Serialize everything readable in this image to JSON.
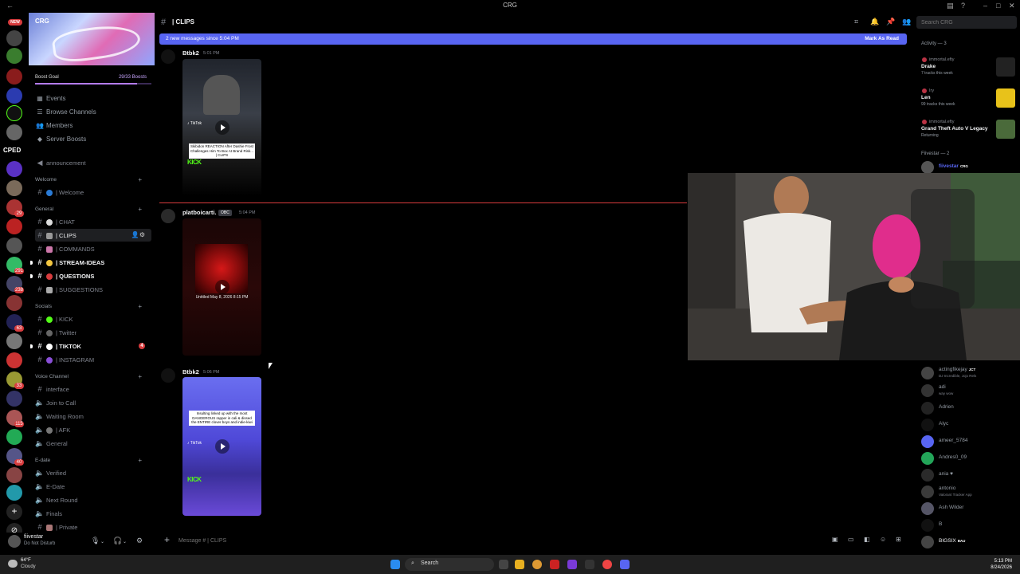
{
  "window": {
    "title": "CRG"
  },
  "rail": {
    "new_badge": "NEW",
    "cped_label": "CPED",
    "badges": [
      "29",
      "291",
      "238",
      "63",
      "33",
      "115",
      "40"
    ]
  },
  "server": {
    "name": "CRG",
    "boost_label": "Boost Goal",
    "boost_value": "29/33 Boosts",
    "boost_progress": 0.88
  },
  "nav": {
    "events": "Events",
    "browse": "Browse Channels",
    "members": "Members",
    "boosts": "Server Boosts"
  },
  "channels": {
    "announcement": "announcement",
    "cat_welcome": "Welcome",
    "welcome": "| Welcome",
    "cat_general": "General",
    "chat": "| CHAT",
    "clips": "| CLIPS",
    "commands": "| COMMANDS",
    "stream_ideas": "| STREAM-IDEAS",
    "questions": "| QUESTIONS",
    "suggestions": "| SUGGESTIONS",
    "cat_socials": "Socials",
    "kick": "| KICK",
    "twitter": "| Twitter",
    "tiktok": "| TIKTOK",
    "tiktok_badge": "4",
    "instagram": "| INSTAGRAM",
    "cat_voice": "Voice Channel",
    "interface": "interface",
    "join_call": "Join to Call",
    "waiting": "Waiting Room",
    "afk": "| AFK",
    "general": "General",
    "cat_edate": "E-date",
    "verified": "Verified",
    "edate": "E-Date",
    "next_round": "Next Round",
    "finals": "Finals",
    "private": "| Private"
  },
  "user": {
    "name": "fiivestar",
    "status": "Do Not Disturb"
  },
  "header": {
    "channel": "| CLIPS",
    "search_placeholder": "Search CRG"
  },
  "new_messages": {
    "text": "2 new messages since 5:04 PM",
    "mark_read": "Mark As Read"
  },
  "messages": [
    {
      "author": "Btbk2",
      "time": "5:01 PM",
      "caption": "Skibidon REACTION After Dashie Frost Challenges Him To Box At Brand Risk... | CLIPS",
      "kick": "KICK"
    },
    {
      "author": "platboicarti.",
      "tag": "OBC",
      "time": "5:04 PM",
      "title": "Untitled May 8, 2026 8:15 PM"
    },
    {
      "author": "Btbk2",
      "time": "5:06 PM",
      "caption": "Insulting linked up with the most DANGEROUS rapper in cali & dissed the ENTIRE clover boys and indie-kiwi",
      "kick": "KICK"
    }
  ],
  "composer": {
    "placeholder": "Message # | CLIPS"
  },
  "activity": {
    "header": "Activity — 3",
    "items": [
      {
        "user": "immortal.efty",
        "title": "Drake",
        "sub": "7 tracks this week"
      },
      {
        "user": "Iry",
        "title": "Len",
        "sub": "99 tracks this week"
      },
      {
        "user": "immortal.efty",
        "title": "Grand Theft Auto V Legacy",
        "sub": "Returning"
      }
    ],
    "group_header": "Fiivestar — 2",
    "group_member": "fiivestar",
    "group_tag": "CRG"
  },
  "members": [
    {
      "name": "actingfikejay",
      "tag": "JCT",
      "sub": "DJ Incredible, Jojo Rels"
    },
    {
      "name": "adi",
      "sub": "way wow"
    },
    {
      "name": "Adrien"
    },
    {
      "name": "Alyc"
    },
    {
      "name": "ameer_5784"
    },
    {
      "name": "Andres0_09"
    },
    {
      "name": "ania ♥"
    },
    {
      "name": "antonio",
      "sub": "Valorant Tracker App"
    },
    {
      "name": "Ash Wilder"
    },
    {
      "name": "B"
    },
    {
      "name": "BIGSIX",
      "tag": "BAU"
    }
  ],
  "taskbar": {
    "temp": "64°F",
    "weather": "Cloudy",
    "search": "Search",
    "time": "5:13 PM",
    "date": "8/24/2026"
  },
  "colors": {
    "accent": "#5865f2",
    "unread_red": "#d83c3e",
    "kick_green": "#53fc18"
  }
}
